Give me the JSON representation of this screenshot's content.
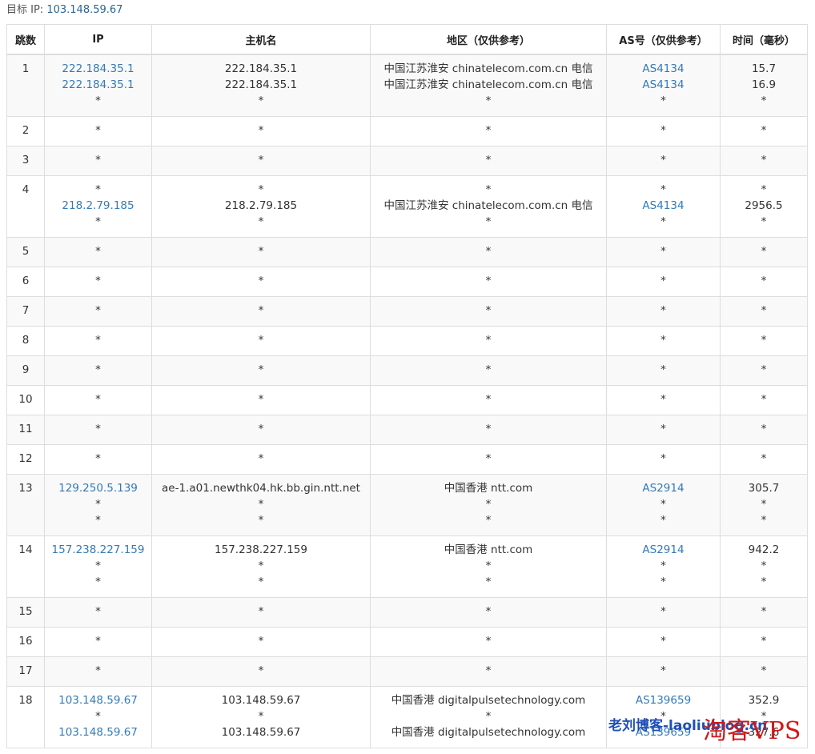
{
  "header": {
    "target_label": "目标 IP:",
    "target_ip": "103.148.59.67"
  },
  "columns": [
    "跳数",
    "IP",
    "主机名",
    "地区（仅供参考）",
    "AS号（仅供参考）",
    "时间（毫秒）"
  ],
  "hops": [
    {
      "hop": "1",
      "ip": [
        "222.184.35.1",
        "222.184.35.1",
        "*"
      ],
      "host": [
        "222.184.35.1",
        "222.184.35.1",
        "*"
      ],
      "region": [
        "中国江苏淮安 chinatelecom.com.cn 电信",
        "中国江苏淮安 chinatelecom.com.cn 电信",
        "*"
      ],
      "as": [
        "AS4134",
        "AS4134",
        "*"
      ],
      "time": [
        "15.7",
        "16.9",
        "*"
      ]
    },
    {
      "hop": "2",
      "ip": [
        "*"
      ],
      "host": [
        "*"
      ],
      "region": [
        "*"
      ],
      "as": [
        "*"
      ],
      "time": [
        "*"
      ]
    },
    {
      "hop": "3",
      "ip": [
        "*"
      ],
      "host": [
        "*"
      ],
      "region": [
        "*"
      ],
      "as": [
        "*"
      ],
      "time": [
        "*"
      ]
    },
    {
      "hop": "4",
      "ip": [
        "*",
        "218.2.79.185",
        "*"
      ],
      "host": [
        "*",
        "218.2.79.185",
        "*"
      ],
      "region": [
        "*",
        "中国江苏淮安 chinatelecom.com.cn 电信",
        "*"
      ],
      "as": [
        "*",
        "AS4134",
        "*"
      ],
      "time": [
        "*",
        "2956.5",
        "*"
      ]
    },
    {
      "hop": "5",
      "ip": [
        "*"
      ],
      "host": [
        "*"
      ],
      "region": [
        "*"
      ],
      "as": [
        "*"
      ],
      "time": [
        "*"
      ]
    },
    {
      "hop": "6",
      "ip": [
        "*"
      ],
      "host": [
        "*"
      ],
      "region": [
        "*"
      ],
      "as": [
        "*"
      ],
      "time": [
        "*"
      ]
    },
    {
      "hop": "7",
      "ip": [
        "*"
      ],
      "host": [
        "*"
      ],
      "region": [
        "*"
      ],
      "as": [
        "*"
      ],
      "time": [
        "*"
      ]
    },
    {
      "hop": "8",
      "ip": [
        "*"
      ],
      "host": [
        "*"
      ],
      "region": [
        "*"
      ],
      "as": [
        "*"
      ],
      "time": [
        "*"
      ]
    },
    {
      "hop": "9",
      "ip": [
        "*"
      ],
      "host": [
        "*"
      ],
      "region": [
        "*"
      ],
      "as": [
        "*"
      ],
      "time": [
        "*"
      ]
    },
    {
      "hop": "10",
      "ip": [
        "*"
      ],
      "host": [
        "*"
      ],
      "region": [
        "*"
      ],
      "as": [
        "*"
      ],
      "time": [
        "*"
      ]
    },
    {
      "hop": "11",
      "ip": [
        "*"
      ],
      "host": [
        "*"
      ],
      "region": [
        "*"
      ],
      "as": [
        "*"
      ],
      "time": [
        "*"
      ]
    },
    {
      "hop": "12",
      "ip": [
        "*"
      ],
      "host": [
        "*"
      ],
      "region": [
        "*"
      ],
      "as": [
        "*"
      ],
      "time": [
        "*"
      ]
    },
    {
      "hop": "13",
      "ip": [
        "129.250.5.139",
        "*",
        "*"
      ],
      "host": [
        "ae-1.a01.newthk04.hk.bb.gin.ntt.net",
        "*",
        "*"
      ],
      "region": [
        "中国香港 ntt.com",
        "*",
        "*"
      ],
      "as": [
        "AS2914",
        "*",
        "*"
      ],
      "time": [
        "305.7",
        "*",
        "*"
      ]
    },
    {
      "hop": "14",
      "ip": [
        "157.238.227.159",
        "*",
        "*"
      ],
      "host": [
        "157.238.227.159",
        "*",
        "*"
      ],
      "region": [
        "中国香港 ntt.com",
        "*",
        "*"
      ],
      "as": [
        "AS2914",
        "*",
        "*"
      ],
      "time": [
        "942.2",
        "*",
        "*"
      ]
    },
    {
      "hop": "15",
      "ip": [
        "*"
      ],
      "host": [
        "*"
      ],
      "region": [
        "*"
      ],
      "as": [
        "*"
      ],
      "time": [
        "*"
      ]
    },
    {
      "hop": "16",
      "ip": [
        "*"
      ],
      "host": [
        "*"
      ],
      "region": [
        "*"
      ],
      "as": [
        "*"
      ],
      "time": [
        "*"
      ]
    },
    {
      "hop": "17",
      "ip": [
        "*"
      ],
      "host": [
        "*"
      ],
      "region": [
        "*"
      ],
      "as": [
        "*"
      ],
      "time": [
        "*"
      ]
    },
    {
      "hop": "18",
      "ip": [
        "103.148.59.67",
        "*",
        "103.148.59.67"
      ],
      "host": [
        "103.148.59.67",
        "*",
        "103.148.59.67"
      ],
      "region": [
        "中国香港 digitalpulsetechnology.com",
        "*",
        "中国香港 digitalpulsetechnology.com"
      ],
      "as": [
        "AS139659",
        "*",
        "AS139659"
      ],
      "time": [
        "352.9",
        "*",
        "327.6"
      ]
    }
  ],
  "watermark": {
    "text_a": "老刘博客-laoliublog.cn",
    "text_b": "淘客VPS"
  },
  "colors": {
    "link": "#337ab7",
    "border": "#dddddd",
    "stripe": "#f9f9f9",
    "watermark_blue": "#1f4fb5",
    "watermark_red": "#d01818"
  }
}
